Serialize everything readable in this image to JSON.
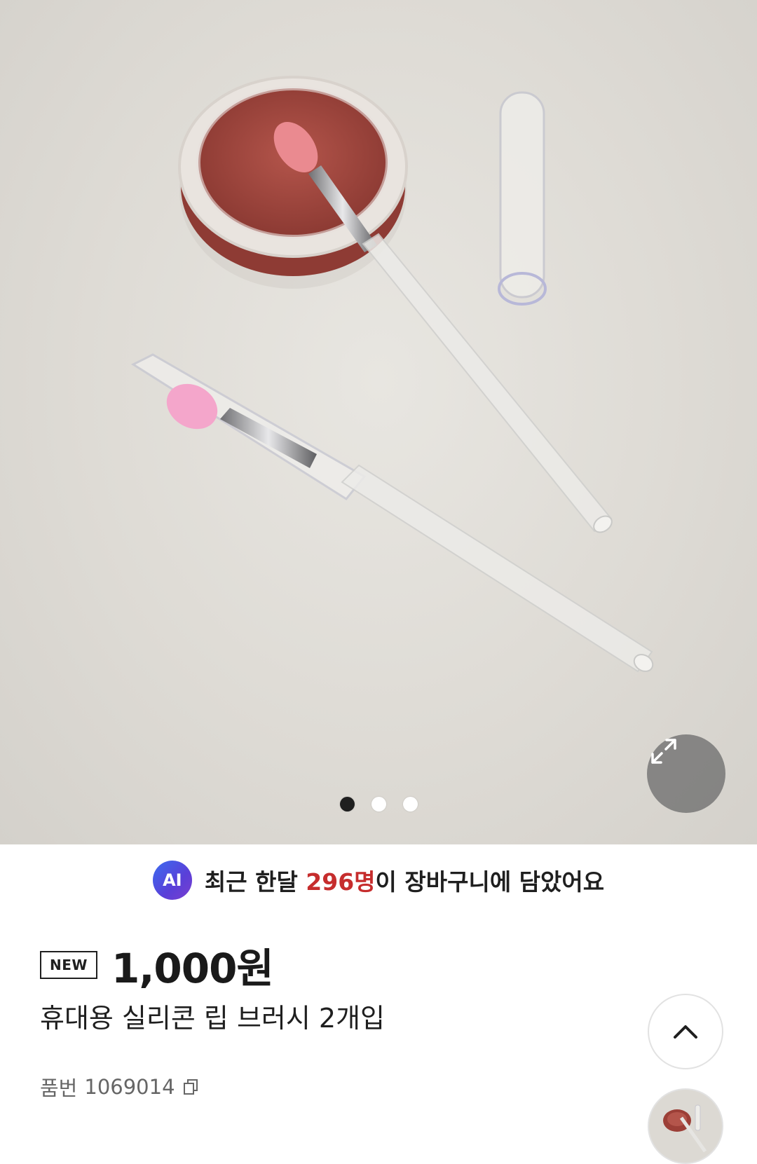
{
  "gallery": {
    "image_alt": "휴대용 실리콘 립 브러시 2개입 product photo",
    "dots": [
      true,
      false,
      false
    ],
    "expand_icon": "expand-arrows-icon"
  },
  "ai_banner": {
    "badge": "AI",
    "prefix": "최근 한달 ",
    "highlight": "296명",
    "suffix": "이 장바구니에 담았어요",
    "highlight_color": "#c62d2d"
  },
  "product": {
    "tag": "NEW",
    "price": "1,000원",
    "name": "휴대용 실리콘 립 브러시 2개입",
    "sku_label": "품번",
    "sku": "1069014"
  },
  "floating": {
    "top_icon": "chevron-up-icon",
    "thumb_icon": "product-thumbnail"
  }
}
